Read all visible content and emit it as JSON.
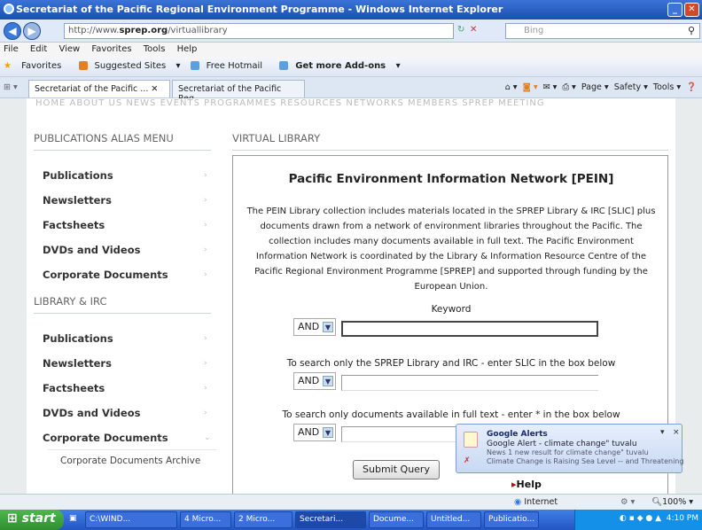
{
  "window": {
    "title": "Secretariat of the Pacific Regional Environment Programme - Windows Internet Explorer"
  },
  "address": {
    "url_prefix": "http://www.",
    "url_host": "sprep.org",
    "url_rest": "/virtuallibrary",
    "search_placeholder": "Bing"
  },
  "menu": [
    "File",
    "Edit",
    "View",
    "Favorites",
    "Tools",
    "Help"
  ],
  "favbar": {
    "favorites": "Favorites",
    "suggested": "Suggested Sites",
    "hotmail": "Free Hotmail",
    "addons": "Get more Add-ons"
  },
  "tabs": [
    "Secretariat of the Pacific ...",
    "Secretariat of the Pacific Reg..."
  ],
  "toolbar_right": {
    "page": "Page",
    "safety": "Safety",
    "tools": "Tools"
  },
  "topnav": "HOME      ABOUT US      NEWS      EVENTS      PROGRAMMES      RESOURCES      NETWORKS      MEMBERS      SPREP MEETING",
  "sidebar": {
    "publications_alias_heading": "PUBLICATIONS ALIAS MENU",
    "items1": [
      "Publications",
      "Newsletters",
      "Factsheets",
      "DVDs and Videos",
      "Corporate Documents"
    ],
    "library_heading": "LIBRARY & IRC",
    "items2": [
      "Publications",
      "Newsletters",
      "Factsheets",
      "DVDs and Videos",
      "Corporate Documents"
    ],
    "sub_item": "Corporate Documents Archive"
  },
  "main": {
    "heading": "VIRTUAL LIBRARY",
    "title": "Pacific Environment Information Network [PEIN]",
    "desc": "The PEIN Library collection includes materials located in the SPREP Library & IRC [SLIC] plus documents drawn from a network of environment libraries throughout the Pacific. The collection includes many documents available in full text. The Pacific Environment Information Network is coordinated by the Library & Information Resource Centre of the Pacific Regional Environment Programme [SPREP] and supported through funding by the European Union.",
    "keyword_label": "Keyword",
    "slic_label": "To search only the SPREP Library and IRC - enter SLIC in the box below",
    "fulltext_label": "To search only documents available in full text - enter * in the box below",
    "operator": "AND",
    "submit": "Submit Query",
    "help": "Help"
  },
  "alert": {
    "title": "Google Alerts",
    "line1": "Google Alert - climate change\" tuvalu",
    "line2": "News    1 new result for climate change\" tuvalu",
    "line3": "Climate Change is Raising Sea Level -- and Threatening"
  },
  "status": {
    "zone": "Internet",
    "zoom": "100%"
  },
  "taskbar": {
    "start": "start",
    "tasks": [
      "C:\\WIND...",
      "4 Micro...",
      "2 Micro...",
      "Secretari...",
      "Docume...",
      "Untitled...",
      "Publicatio..."
    ],
    "clock": "4:10 PM"
  }
}
